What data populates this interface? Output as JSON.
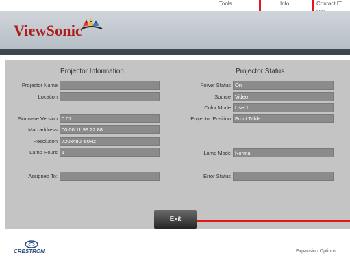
{
  "nav": {
    "tools": "Tools",
    "info": "Info",
    "contact": "Contact IT Hel"
  },
  "brand": {
    "logo_text": "ViewSonic",
    "logo_color": "#b01b1b"
  },
  "projector_info": {
    "title": "Projector Information",
    "fields": [
      {
        "label": "Projector Name",
        "value": ""
      },
      {
        "label": "Location",
        "value": ""
      },
      {
        "label": "Firmware Version",
        "value": "0.07"
      },
      {
        "label": "Mac address",
        "value": "00:00:11:99:22:88"
      },
      {
        "label": "Resolution",
        "value": "720x480i 60Hz"
      },
      {
        "label": "Lamp Hours",
        "value": "1"
      },
      {
        "label": "Assigned To:",
        "value": ""
      }
    ]
  },
  "projector_status": {
    "title": "Projector Status",
    "fields": [
      {
        "label": "Power Status",
        "value": "On"
      },
      {
        "label": "Source",
        "value": "Video"
      },
      {
        "label": "Color Mode",
        "value": "User1"
      },
      {
        "label": "Projector Position",
        "value": "Front Table"
      },
      {
        "label": "Lamp Mode",
        "value": "Normal"
      },
      {
        "label": "Error Status",
        "value": ""
      }
    ]
  },
  "exit_label": "Exit",
  "footer": {
    "crestron_text": "CRESTRON.",
    "expansion_label": "Expansion Options"
  },
  "colors": {
    "highlight": "#e01818",
    "panel": "#c4c4c4",
    "field": "#8b8b8b",
    "banner": "#c4cbd1"
  }
}
